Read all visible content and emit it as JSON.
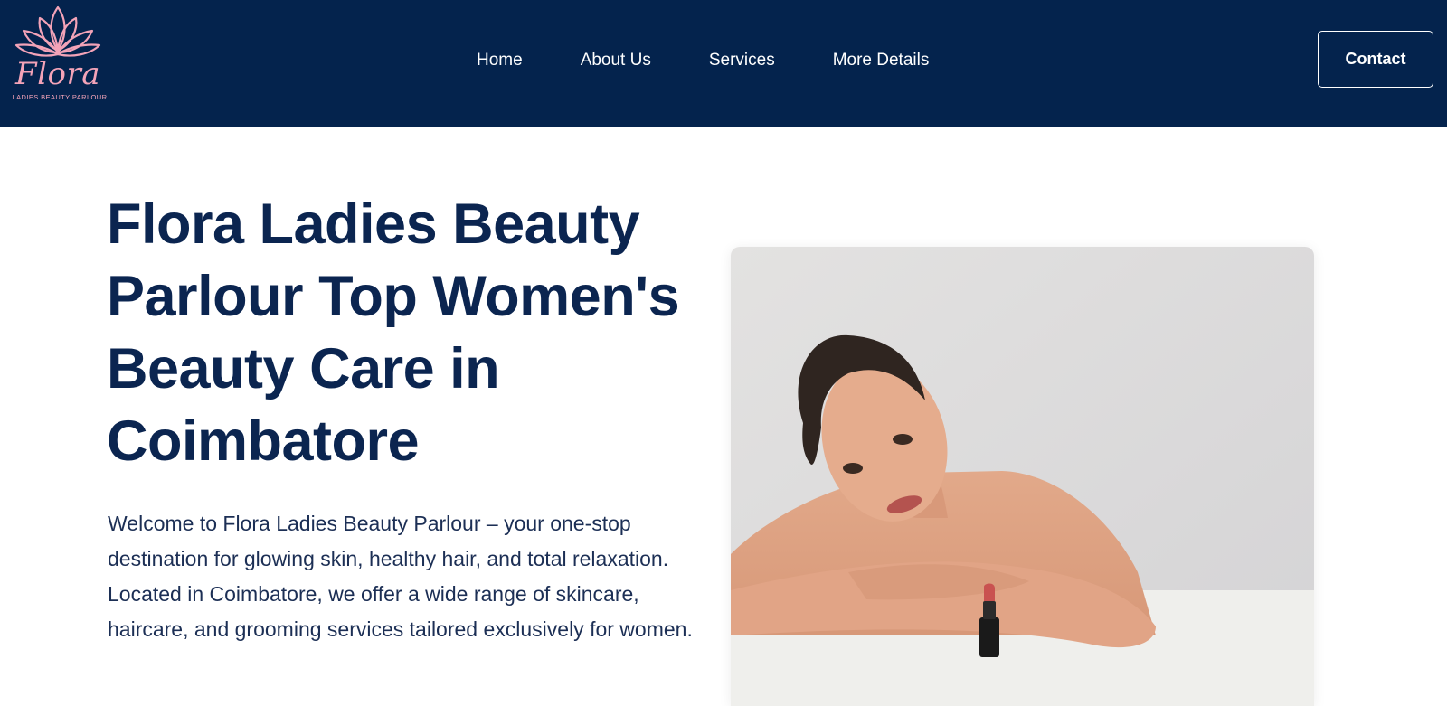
{
  "brand": {
    "logo_word": "Flora",
    "logo_tagline": "LADIES BEAUTY PARLOUR",
    "logo_color": "#f3a3b8"
  },
  "header": {
    "background": "#04234d",
    "nav": [
      {
        "label": "Home"
      },
      {
        "label": "About Us"
      },
      {
        "label": "Services"
      },
      {
        "label": "More Details"
      }
    ],
    "contact_label": "Contact"
  },
  "hero": {
    "title": "Flora Ladies Beauty Parlour Top Women's Beauty Care in Coimbatore",
    "text": "Welcome to Flora Ladies Beauty Parlour – your one-stop destination for glowing skin, healthy hair, and total relaxation. Located in Coimbatore, we offer a wide range of skincare, haircare, and grooming services tailored exclusively for women.",
    "title_color": "#0b2550"
  }
}
